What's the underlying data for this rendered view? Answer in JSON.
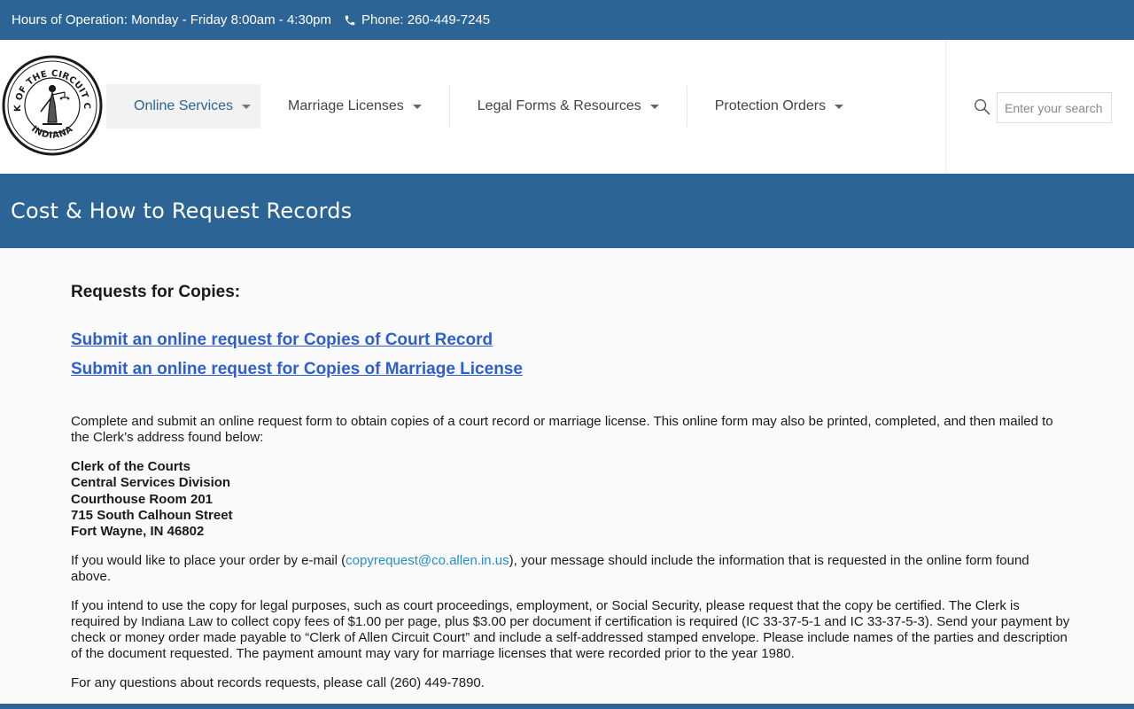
{
  "topbar": {
    "hours": "Hours of Operation: Monday - Friday 8:00am - 4:30pm",
    "phone": "Phone: 260-449-7245"
  },
  "logo": {
    "ring_text_top": "CLERK OF THE CIRCUIT COURT",
    "ring_text_bottom": "INDIANA"
  },
  "nav": {
    "items": [
      {
        "label": "Online Services",
        "active": true
      },
      {
        "label": "Marriage Licenses",
        "active": false
      },
      {
        "label": "Legal Forms & Resources",
        "active": false
      },
      {
        "label": "Protection Orders",
        "active": false
      }
    ]
  },
  "search": {
    "placeholder": "Enter your search"
  },
  "banner": {
    "title": "Cost & How to Request Records"
  },
  "content": {
    "heading": "Requests for Copies:",
    "link_court_record": "Submit an online request for Copies of Court Record",
    "link_marriage_license": "Submit an online request for Copies of Marriage License",
    "intro": "Complete and submit an online request form to obtain copies of a court record or marriage license.  This online form may also be printed, completed, and then mailed to the Clerk’s address found below:",
    "address": {
      "line1": "Clerk of the Courts",
      "line2": "Central Services Division",
      "line3": "Courthouse Room 201",
      "line4": "715 South Calhoun Street",
      "line5": "Fort Wayne, IN  46802"
    },
    "email_before": "If you would like to place your order by e-mail (",
    "email": "copyrequest@co.allen.in.us",
    "email_after": "), your message should include the information that is requested in the online form found above.",
    "legal": "If you intend to use the copy for legal purposes, such as court proceedings, employment, or Social Security, please request that the copy be certified. The Clerk is required by Indiana Law to collect copy fees of $1.00 per page, plus $3.00 per document if certification is required (IC 33-37-5-1 and IC 33-37-5-3). Send your payment by check or money order made payable to “Clerk of Allen Circuit Court” and include a self-addressed stamped envelope.  Please include names of the parties and description of the document requested.  The payment amount may vary for marriage licenses that were recorded prior to the year 1980.",
    "questions": "For any questions about records requests, please call (260) 449-7890."
  },
  "colors": {
    "brand_blue": "#2b6495",
    "link_blue": "#2f5ecf",
    "email_blue": "#1f8fcf"
  }
}
